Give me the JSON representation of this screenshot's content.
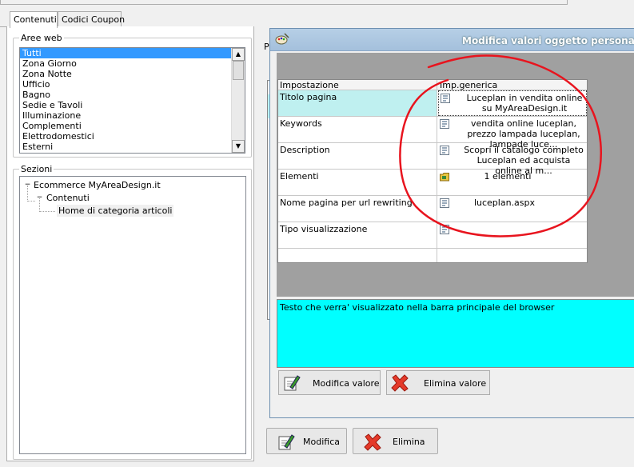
{
  "tabs": [
    {
      "label": "Contenuti",
      "active": true
    },
    {
      "label": "Codici Coupon",
      "active": false
    }
  ],
  "aree_web": {
    "legend": "Aree web",
    "items": [
      "Tutti",
      "Zona Giorno",
      "Zona Notte",
      "Ufficio",
      "Bagno",
      "Sedie e Tavoli",
      "Illuminazione",
      "Complementi",
      "Elettrodomestici",
      "Esterni"
    ],
    "selected_index": 0
  },
  "sezioni": {
    "legend": "Sezioni",
    "tree": {
      "root": "Ecommerce MyAreaDesign.it",
      "child": "Contenuti",
      "leaf": "Home di categoria articoli"
    }
  },
  "main": {
    "partial_label": "P"
  },
  "buttons": {
    "modifica": "Modifica",
    "elimina": "Elimina"
  },
  "dialog": {
    "title": "Modifica valori oggetto personalizz",
    "grid": {
      "header_left": "Impostazione",
      "header_right": "Imp.generica",
      "rows": [
        {
          "name": "Titolo pagina",
          "value": "Luceplan in vendita online su MyAreaDesign.it",
          "icon": "text-icon",
          "selected": true
        },
        {
          "name": "Keywords",
          "value": "vendita online luceplan, prezzo lampada luceplan, lampade luce...",
          "icon": "text-icon"
        },
        {
          "name": "Description",
          "value": "Scopri il catalogo completo Luceplan ed acquista online al m...",
          "icon": "text-icon"
        },
        {
          "name": "Elementi",
          "value": "1 elementi",
          "icon": "folder-icon"
        },
        {
          "name": "Nome pagina per url rewriting",
          "value": "luceplan.aspx",
          "icon": "text-icon"
        },
        {
          "name": "Tipo visualizzazione",
          "value": "",
          "icon": "text-icon"
        }
      ]
    },
    "description": "Testo che verra' visualizzato nella barra principale del browser",
    "btn_modifica_valore": "Modifica valore",
    "btn_elimina_valore": "Elimina valore"
  },
  "colors": {
    "selection": "#3399ff",
    "cyan": "#00ffff",
    "annotation": "#e8141e"
  }
}
